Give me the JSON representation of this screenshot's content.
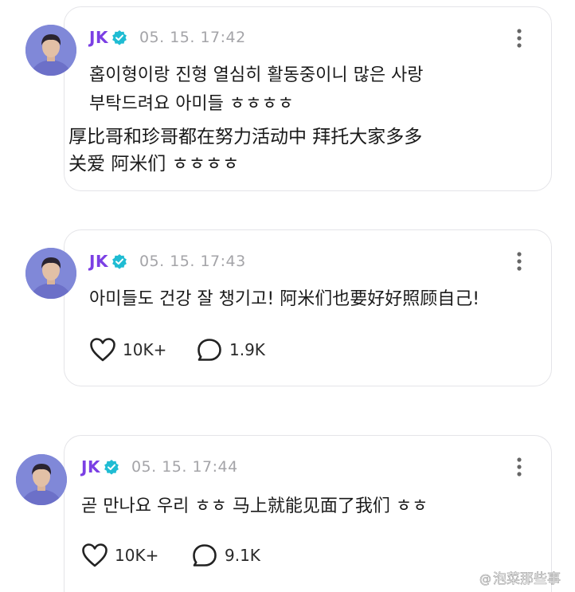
{
  "posts": [
    {
      "username": "JK",
      "timestamp": "05. 15. 17:42",
      "lines": [
        "홉이형이랑 진형 열심히 활동중이니 많은 사랑",
        "부탁드려요 아미들 ㅎㅎㅎㅎ",
        "厚比哥和珍哥都在努力活动中  拜托大家多多",
        "关爱  阿米们 ㅎㅎㅎㅎ"
      ]
    },
    {
      "username": "JK",
      "timestamp": "05. 15. 17:43",
      "lines": [
        "아미들도 건강 잘 챙기고! 阿米们也要好好照顾自己!"
      ],
      "likes": "10K+",
      "comments": "1.9K"
    },
    {
      "username": "JK",
      "timestamp": "05. 15. 17:44",
      "lines": [
        "곧 만나요 우리 ㅎㅎ  马上就能见面了我们  ㅎㅎ"
      ],
      "likes": "10K+",
      "comments": "9.1K"
    }
  ],
  "icons": {
    "verified": "verified-badge-icon",
    "more": "more-vertical-icon",
    "like": "heart-outline-icon",
    "comment": "speech-bubble-outline-icon"
  },
  "colors": {
    "username": "#7b3fe4",
    "verified": "#1fbcd3",
    "timestamp": "#a4a4a8",
    "card_border": "#e4e4e8"
  },
  "watermark": {
    "text": "泡菜那些事"
  }
}
